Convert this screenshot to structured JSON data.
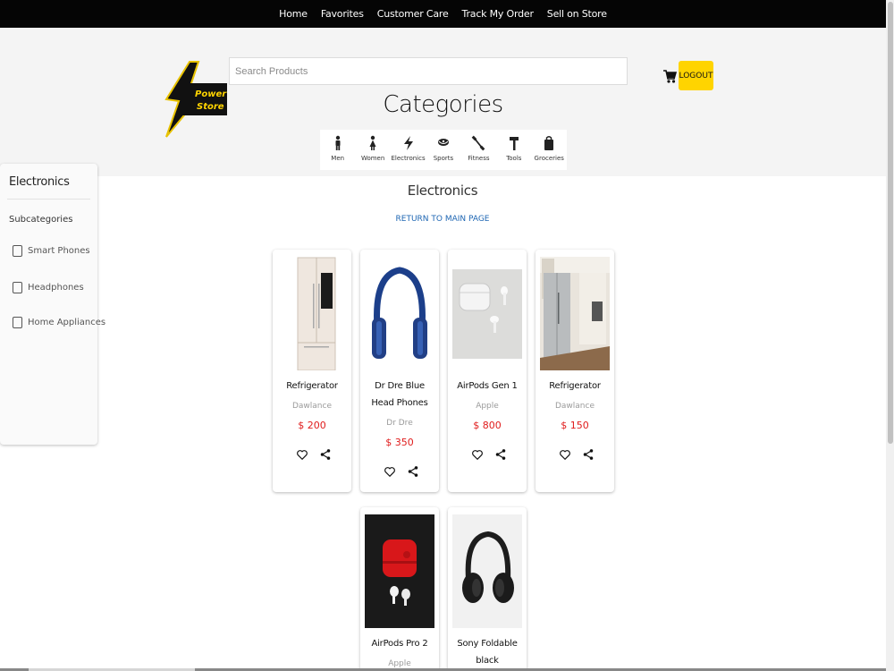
{
  "nav": {
    "links": [
      "Home",
      "Favorites",
      "Customer Care",
      "Track My Order",
      "Sell on Store"
    ]
  },
  "header": {
    "logo_text_line1": "Power",
    "logo_text_line2": "Store",
    "search_placeholder": "Search Products",
    "logout_label": "LOGOUT",
    "categories_title": "Categories"
  },
  "categories": [
    {
      "label": "Men",
      "icon": "man-icon"
    },
    {
      "label": "Women",
      "icon": "woman-icon"
    },
    {
      "label": "Electronics",
      "icon": "bolt-icon"
    },
    {
      "label": "Sports",
      "icon": "ball-icon"
    },
    {
      "label": "Fitness",
      "icon": "dumbbell-icon"
    },
    {
      "label": "Tools",
      "icon": "hammer-icon"
    },
    {
      "label": "Groceries",
      "icon": "bag-icon"
    }
  ],
  "sidebar": {
    "title": "Electronics",
    "subtitle": "Subcategories",
    "options": [
      "Smart Phones",
      "Headphones",
      "Home Appliances"
    ]
  },
  "main": {
    "title": "Electronics",
    "return_link": "RETURN TO MAIN PAGE"
  },
  "products": [
    {
      "name": "Refrigerator",
      "brand": "Dawlance",
      "price": "$ 200"
    },
    {
      "name": "Dr Dre Blue Head Phones",
      "brand": "Dr Dre",
      "price": "$ 350"
    },
    {
      "name": "AirPods Gen 1",
      "brand": "Apple",
      "price": "$ 800"
    },
    {
      "name": "Refrigerator",
      "brand": "Dawlance",
      "price": "$ 150"
    },
    {
      "name": "AirPods Pro 2",
      "brand": "Apple",
      "price": ""
    },
    {
      "name": "Sony Foldable black",
      "brand": "",
      "price": ""
    }
  ],
  "colors": {
    "accent_yellow": "#ffd400",
    "price_red": "#e01b1b",
    "link_blue": "#1e66b3",
    "nav_black": "#050505"
  }
}
